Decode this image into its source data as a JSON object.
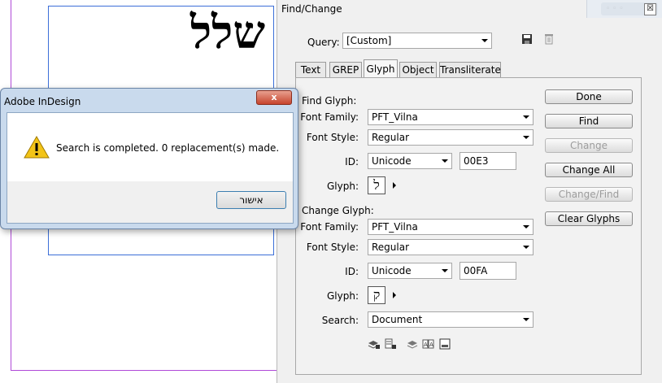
{
  "document": {
    "hebrew_text": "שלל"
  },
  "panel": {
    "title": "Find/Change",
    "close_glyph": "☒",
    "query_label": "Query:",
    "query_value": "[Custom]",
    "tabs": [
      "Text",
      "GREP",
      "Glyph",
      "Object",
      "Transliterate"
    ],
    "active_tab": "Glyph",
    "find_glyph": {
      "section_label": "Find Glyph:",
      "font_family_label": "Font Family:",
      "font_family_value": "PFT_Vilna",
      "font_style_label": "Font Style:",
      "font_style_value": "Regular",
      "id_label": "ID:",
      "id_type": "Unicode",
      "id_value": "00E3",
      "glyph_label": "Glyph:",
      "glyph_char": "ל"
    },
    "change_glyph": {
      "section_label": "Change Glyph:",
      "font_family_label": "Font Family:",
      "font_family_value": "PFT_Vilna",
      "font_style_label": "Font Style:",
      "font_style_value": "Regular",
      "id_label": "ID:",
      "id_type": "Unicode",
      "id_value": "00FA",
      "glyph_label": "Glyph:",
      "glyph_char": "ק"
    },
    "search_label": "Search:",
    "search_value": "Document",
    "buttons": {
      "done": "Done",
      "find": "Find",
      "change": "Change",
      "change_all": "Change All",
      "change_find": "Change/Find",
      "clear_glyphs": "Clear Glyphs"
    },
    "icons": [
      "save-query-icon",
      "delete-query-icon",
      "include-locked-layers-icon",
      "include-locked-stories-icon",
      "include-hidden-layers-icon",
      "include-master-pages-icon",
      "include-footnotes-icon"
    ]
  },
  "dialog": {
    "title": "Adobe InDesign",
    "close_glyph": "x",
    "message": "Search is completed.  0 replacement(s) made.",
    "ok_label": "אישור"
  },
  "colors": {
    "dialog_frame": "#c9daed",
    "close_red": "#c7442d",
    "page_margin": "#b04ad8",
    "page_frame": "#3c6fd8"
  }
}
